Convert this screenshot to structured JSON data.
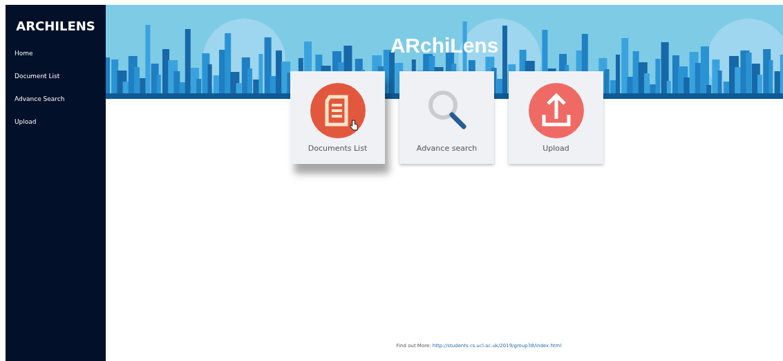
{
  "sidebar": {
    "title": "ARCHILENS",
    "items": [
      {
        "label": "Home"
      },
      {
        "label": "Document List"
      },
      {
        "label": "Advance Search"
      },
      {
        "label": "Upload"
      }
    ]
  },
  "banner": {
    "title": "ARchiLens"
  },
  "cards": [
    {
      "kind": "document",
      "label": "Documents List",
      "hovered": true
    },
    {
      "kind": "search",
      "label": "Advance search",
      "hovered": false
    },
    {
      "kind": "upload",
      "label": "Upload",
      "hovered": false
    }
  ],
  "footer": {
    "text": "Find out More:",
    "link": "http://students.cs.ucl.ac.uk/2019/group38/index.html"
  }
}
